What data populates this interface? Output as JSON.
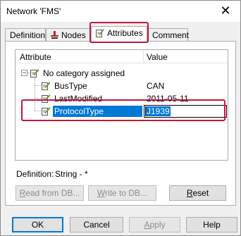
{
  "window": {
    "title": "Network 'FMS'",
    "close_glyph": "✕"
  },
  "tabs": [
    {
      "label": "Definition",
      "icon": null
    },
    {
      "label": "Nodes",
      "icon": "node-icon"
    },
    {
      "label": "Attributes",
      "icon": "pencil-note-icon",
      "active": true
    },
    {
      "label": "Comment",
      "icon": null
    }
  ],
  "tree": {
    "headers": {
      "attribute": "Attribute",
      "value": "Value"
    },
    "category": {
      "label": "No category assigned",
      "expander": "−"
    },
    "rows": [
      {
        "name": "BusType",
        "value": "CAN"
      },
      {
        "name": "LastModified",
        "value": "2011-05-11"
      },
      {
        "name": "ProtocolType",
        "value": "J1939",
        "selected": true,
        "editing": true
      }
    ]
  },
  "definition": {
    "label": "Definition:",
    "value": "String - *"
  },
  "buttons": {
    "read_from_db": {
      "prefix": "",
      "accel": "R",
      "rest": "ead from DB..."
    },
    "write_to_db": {
      "prefix": "",
      "accel": "W",
      "rest": "rite to DB..."
    },
    "reset": {
      "prefix": "",
      "accel": "R",
      "rest": "eset"
    }
  },
  "footer": {
    "ok": "OK",
    "cancel": "Cancel",
    "apply": {
      "accel": "A",
      "rest": "pply"
    },
    "help": "Help"
  },
  "colors": {
    "selection": "#0078d7",
    "highlight_annotation": "#c0163d"
  }
}
